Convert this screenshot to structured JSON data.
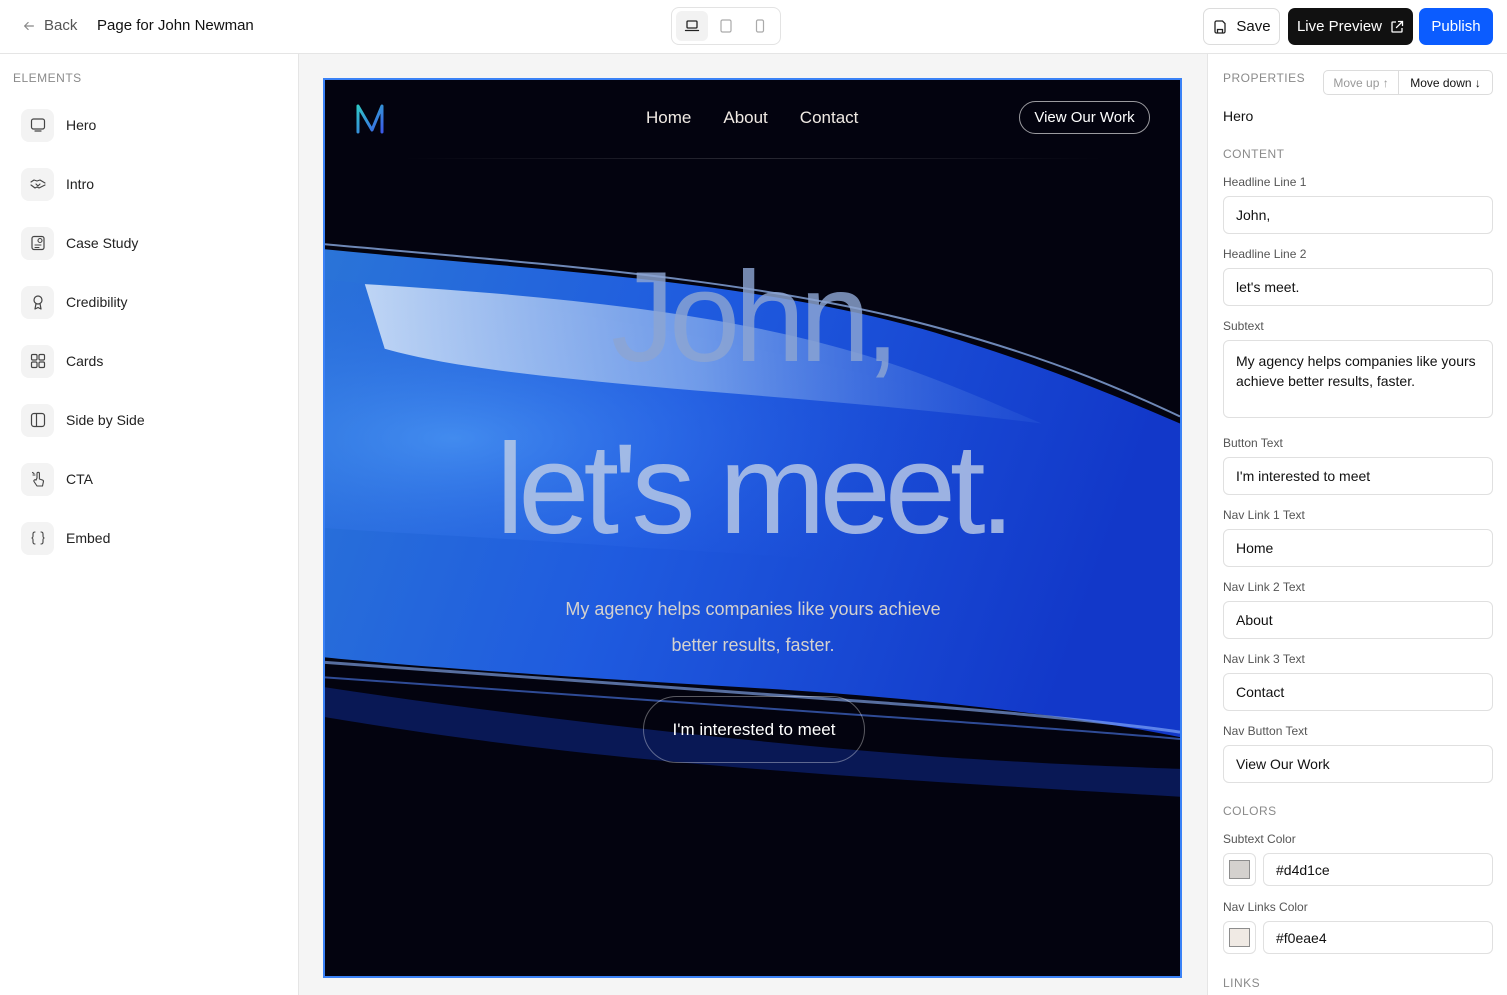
{
  "topbar": {
    "back_label": "Back",
    "page_title": "Page for John Newman",
    "save_label": "Save",
    "live_preview_label": "Live Preview",
    "publish_label": "Publish"
  },
  "sidebar": {
    "heading": "ELEMENTS",
    "items": [
      {
        "label": "Hero",
        "icon": "hero-icon"
      },
      {
        "label": "Intro",
        "icon": "handshake-icon"
      },
      {
        "label": "Case Study",
        "icon": "case-study-icon"
      },
      {
        "label": "Credibility",
        "icon": "award-icon"
      },
      {
        "label": "Cards",
        "icon": "grid-icon"
      },
      {
        "label": "Side by Side",
        "icon": "side-by-side-icon"
      },
      {
        "label": "CTA",
        "icon": "pointer-icon"
      },
      {
        "label": "Embed",
        "icon": "braces-icon"
      }
    ]
  },
  "hero": {
    "nav": [
      "Home",
      "About",
      "Contact"
    ],
    "nav_button": "View Our Work",
    "headline1": "John,",
    "headline2": "let's meet.",
    "subtext_line1": "My agency helps companies like yours achieve",
    "subtext_line2": "better results, faster.",
    "button": "I'm interested to meet",
    "colors": {
      "subtext": "#d4d1ce",
      "nav_links": "#f0eae4",
      "selection": "#3b82f6",
      "publish": "#0b5cff"
    }
  },
  "properties": {
    "heading": "PROPERTIES",
    "move_up": "Move up ↑",
    "move_down": "Move down ↓",
    "section_name": "Hero",
    "content_label": "CONTENT",
    "fields": [
      {
        "label": "Headline Line 1",
        "value": "John,"
      },
      {
        "label": "Headline Line 2",
        "value": "let's meet."
      },
      {
        "label": "Subtext",
        "value": "My agency helps companies like yours achieve better results, faster."
      },
      {
        "label": "Button Text",
        "value": "I'm interested to meet"
      },
      {
        "label": "Nav Link 1 Text",
        "value": "Home"
      },
      {
        "label": "Nav Link 2 Text",
        "value": "About"
      },
      {
        "label": "Nav Link 3 Text",
        "value": "Contact"
      },
      {
        "label": "Nav Button Text",
        "value": "View Our Work"
      }
    ],
    "colors_label": "COLORS",
    "subtext_color_label": "Subtext Color",
    "subtext_color_value": "#d4d1ce",
    "nav_links_color_label": "Nav Links Color",
    "nav_links_color_value": "#f0eae4",
    "links_label": "LINKS"
  }
}
